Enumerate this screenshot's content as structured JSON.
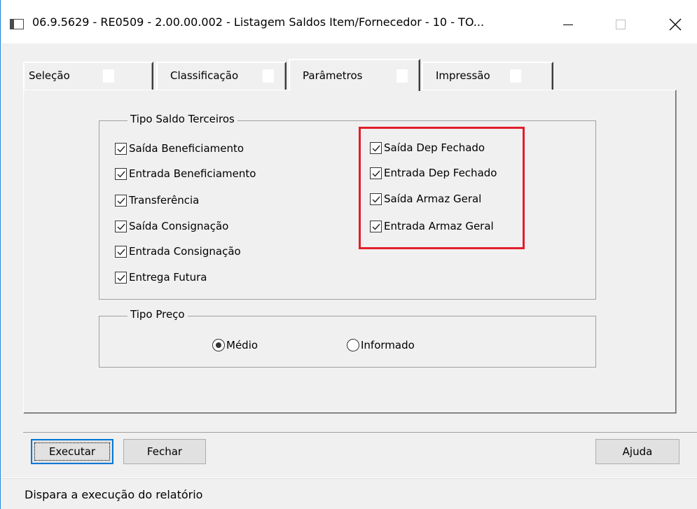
{
  "window": {
    "title": "06.9.5629 - RE0509 - 2.00.00.002 - Listagem Saldos Item/Fornecedor - 10 - TO...",
    "icon": "app-window-icon"
  },
  "tabs": [
    {
      "label": "Seleção",
      "active": false
    },
    {
      "label": "Classificação",
      "active": false
    },
    {
      "label": "Parâmetros",
      "active": true
    },
    {
      "label": "Impressão",
      "active": false
    }
  ],
  "tipo_saldo": {
    "caption": "Tipo Saldo Terceiros",
    "left_items": [
      {
        "label": "Saída Beneficiamento",
        "checked": true
      },
      {
        "label": "Entrada Beneficiamento",
        "checked": true
      },
      {
        "label": "Transferência",
        "checked": true
      },
      {
        "label": "Saída Consignação",
        "checked": true
      },
      {
        "label": "Entrada Consignação",
        "checked": true
      },
      {
        "label": "Entrega Futura",
        "checked": true
      }
    ],
    "right_items": [
      {
        "label": "Saída Dep Fechado",
        "checked": true
      },
      {
        "label": "Entrada Dep Fechado",
        "checked": true
      },
      {
        "label": "Saída Armaz Geral",
        "checked": true
      },
      {
        "label": "Entrada Armaz Geral",
        "checked": true
      }
    ]
  },
  "tipo_preco": {
    "caption": "Tipo Preço",
    "options": [
      {
        "label": "Médio",
        "selected": true
      },
      {
        "label": "Informado",
        "selected": false
      }
    ]
  },
  "buttons": {
    "executar": "Executar",
    "fechar": "Fechar",
    "ajuda": "Ajuda"
  },
  "status_text": "Dispara a execução do relatório",
  "colors": {
    "highlight": "#e31d2b",
    "window_border": "#1883d7",
    "face": "#f0f0f0"
  }
}
